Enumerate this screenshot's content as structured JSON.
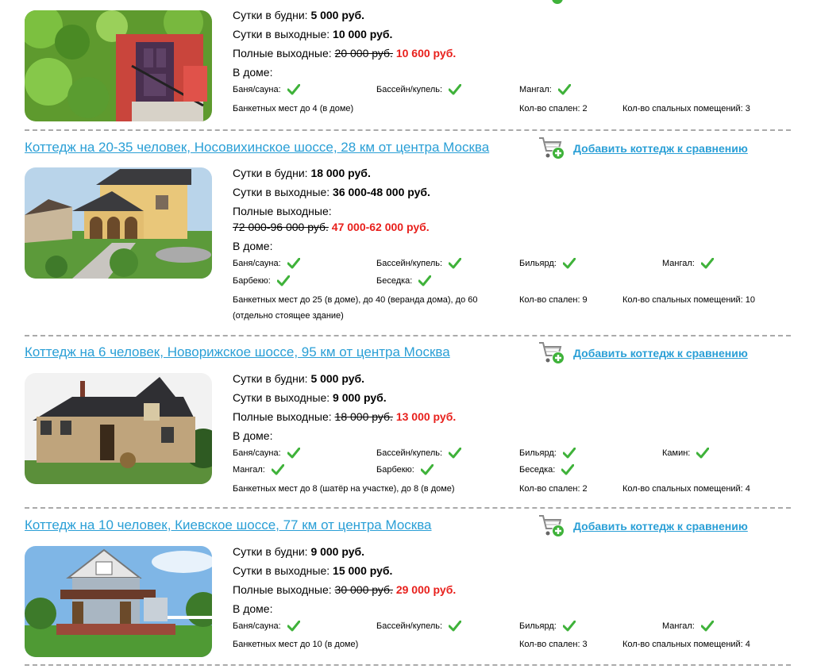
{
  "labels": {
    "compare": "Добавить коттедж к сравнению",
    "weekday": "Сутки в будни:",
    "weekend": "Сутки в выходные:",
    "full_weekend": "Полные выходные:",
    "in_house": "В доме:"
  },
  "colors": {
    "link": "#2a9fd6",
    "price_new": "#e8201c",
    "check": "#3fb23a",
    "divider": "#aaaaaa"
  },
  "icons": {
    "cart": "cart-add-icon",
    "check": "check-icon"
  },
  "listings": [
    {
      "weekday": "5 000 руб.",
      "weekend": "10 000 руб.",
      "full_old": "20 000 руб.",
      "full_new": "10 600 руб.",
      "amenities": [
        "Баня/сауна:",
        "Бассейн/купель:",
        "Мангал:"
      ],
      "banquet": "Банкетных мест до 4 (в доме)",
      "bedrooms": "Кол-во спален: 2",
      "sleeping": "Кол-во спальных помещений: 3"
    },
    {
      "title": "Коттедж на 20-35 человек, Носовихинское шоссе, 28 км от центра Москва",
      "weekday": "18 000 руб.",
      "weekend": "36 000-48 000 руб.",
      "full_old": "72 000-96 000 руб.",
      "full_new": "47 000-62 000 руб.",
      "amenities": [
        "Баня/сауна:",
        "Бассейн/купель:",
        "Бильярд:",
        "Мангал:",
        "Барбекю:",
        "Беседка:"
      ],
      "banquet": "Банкетных мест до 25 (в доме), до 40 (веранда дома), до 60 (отдельно стоящее здание)",
      "bedrooms": "Кол-во спален: 9",
      "sleeping": "Кол-во спальных помещений: 10"
    },
    {
      "title": "Коттедж на 6 человек, Новорижское шоссе, 95 км от центра Москва",
      "weekday": "5 000 руб.",
      "weekend": "9 000 руб.",
      "full_old": "18 000 руб.",
      "full_new": "13 000 руб.",
      "amenities": [
        "Баня/сауна:",
        "Бассейн/купель:",
        "Бильярд:",
        "Камин:",
        "Мангал:",
        "Барбекю:",
        "Беседка:"
      ],
      "banquet": "Банкетных мест до 8 (шатёр на участке), до 8 (в доме)",
      "bedrooms": "Кол-во спален: 2",
      "sleeping": "Кол-во спальных помещений: 4"
    },
    {
      "title": "Коттедж на 10 человек, Киевское шоссе, 77 км от центра Москва",
      "weekday": "9 000 руб.",
      "weekend": "15 000 руб.",
      "full_old": "30 000 руб.",
      "full_new": "29 000 руб.",
      "amenities": [
        "Баня/сауна:",
        "Бассейн/купель:",
        "Бильярд:",
        "Мангал:"
      ],
      "banquet": "Банкетных мест до 10 (в доме)",
      "bedrooms": "Кол-во спален: 3",
      "sleeping": "Кол-во спальных помещений: 4"
    }
  ]
}
